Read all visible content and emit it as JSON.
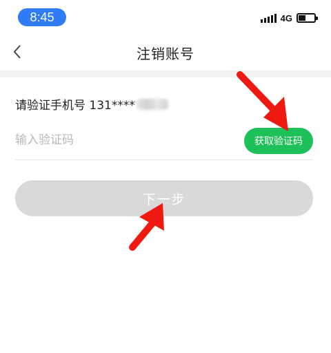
{
  "status": {
    "time": "8:45",
    "network": "4G"
  },
  "nav": {
    "title": "注销账号",
    "back_icon": "chevron-left-icon"
  },
  "verify": {
    "phone_prompt": "请验证手机号 131****",
    "code_placeholder": "输入验证码",
    "code_value": "",
    "get_code_label": "获取验证码"
  },
  "actions": {
    "next_label": "下一步"
  },
  "colors": {
    "time_pill": "#2f7cf6",
    "get_code_button": "#1ec05a",
    "next_button_disabled": "#d9d9d9",
    "annotation_arrow": "#ee1a12",
    "section_gap": "#f3f3f3"
  }
}
